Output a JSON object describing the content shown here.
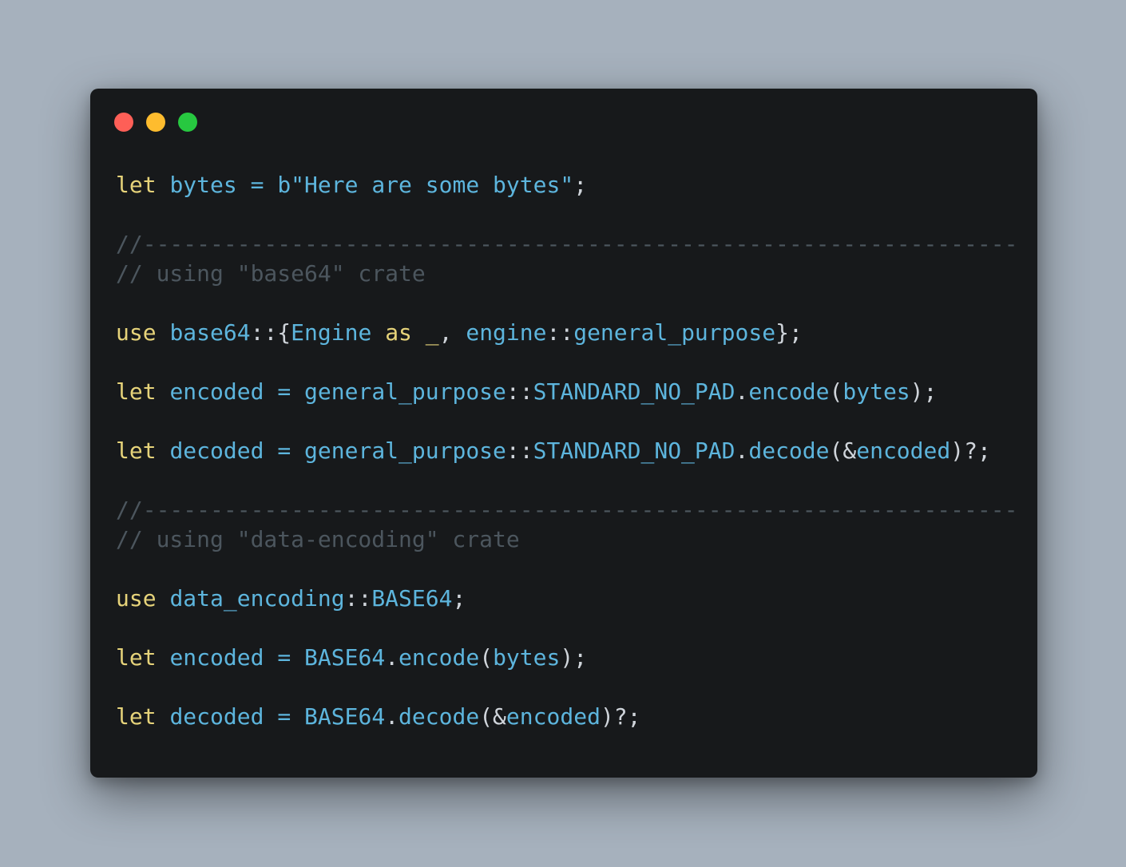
{
  "window": {
    "traffic_lights": [
      {
        "name": "close",
        "color": "#fe5f57"
      },
      {
        "name": "minimize",
        "color": "#febc2e"
      },
      {
        "name": "maximize",
        "color": "#27c840"
      }
    ]
  },
  "colors": {
    "background": "#a6b1bd",
    "editor": "#17191b",
    "keyword": "#e6d37a",
    "identifier": "#5db5dd",
    "punctuation": "#cfd4da",
    "comment": "#4c565e"
  },
  "code": {
    "lines": [
      [
        [
          "kw",
          "let"
        ],
        [
          "pn",
          " "
        ],
        [
          "id",
          "bytes"
        ],
        [
          "pn",
          " "
        ],
        [
          "id",
          "="
        ],
        [
          "pn",
          " "
        ],
        [
          "id",
          "b\"Here are some bytes\""
        ],
        [
          "pn",
          ";"
        ]
      ],
      [],
      [
        [
          "cm",
          "//-----------------------------------------------------------------"
        ]
      ],
      [
        [
          "cm",
          "// using \"base64\" crate"
        ]
      ],
      [],
      [
        [
          "kw",
          "use"
        ],
        [
          "pn",
          " "
        ],
        [
          "id",
          "base64"
        ],
        [
          "pn",
          "::{"
        ],
        [
          "id",
          "Engine"
        ],
        [
          "pn",
          " "
        ],
        [
          "kw",
          "as"
        ],
        [
          "pn",
          " "
        ],
        [
          "kw",
          "_"
        ],
        [
          "pn",
          ", "
        ],
        [
          "id",
          "engine"
        ],
        [
          "pn",
          "::"
        ],
        [
          "id",
          "general_purpose"
        ],
        [
          "pn",
          "};"
        ]
      ],
      [],
      [
        [
          "kw",
          "let"
        ],
        [
          "pn",
          " "
        ],
        [
          "id",
          "encoded"
        ],
        [
          "pn",
          " "
        ],
        [
          "id",
          "="
        ],
        [
          "pn",
          " "
        ],
        [
          "id",
          "general_purpose"
        ],
        [
          "pn",
          "::"
        ],
        [
          "id",
          "STANDARD_NO_PAD"
        ],
        [
          "pn",
          "."
        ],
        [
          "id",
          "encode"
        ],
        [
          "pn",
          "("
        ],
        [
          "id",
          "bytes"
        ],
        [
          "pn",
          ");"
        ]
      ],
      [],
      [
        [
          "kw",
          "let"
        ],
        [
          "pn",
          " "
        ],
        [
          "id",
          "decoded"
        ],
        [
          "pn",
          " "
        ],
        [
          "id",
          "="
        ],
        [
          "pn",
          " "
        ],
        [
          "id",
          "general_purpose"
        ],
        [
          "pn",
          "::"
        ],
        [
          "id",
          "STANDARD_NO_PAD"
        ],
        [
          "pn",
          "."
        ],
        [
          "id",
          "decode"
        ],
        [
          "pn",
          "(&"
        ],
        [
          "id",
          "encoded"
        ],
        [
          "pn",
          ")?;"
        ]
      ],
      [],
      [
        [
          "cm",
          "//-----------------------------------------------------------------"
        ]
      ],
      [
        [
          "cm",
          "// using \"data-encoding\" crate"
        ]
      ],
      [],
      [
        [
          "kw",
          "use"
        ],
        [
          "pn",
          " "
        ],
        [
          "id",
          "data_encoding"
        ],
        [
          "pn",
          "::"
        ],
        [
          "id",
          "BASE64"
        ],
        [
          "pn",
          ";"
        ]
      ],
      [],
      [
        [
          "kw",
          "let"
        ],
        [
          "pn",
          " "
        ],
        [
          "id",
          "encoded"
        ],
        [
          "pn",
          " "
        ],
        [
          "id",
          "="
        ],
        [
          "pn",
          " "
        ],
        [
          "id",
          "BASE64"
        ],
        [
          "pn",
          "."
        ],
        [
          "id",
          "encode"
        ],
        [
          "pn",
          "("
        ],
        [
          "id",
          "bytes"
        ],
        [
          "pn",
          ");"
        ]
      ],
      [],
      [
        [
          "kw",
          "let"
        ],
        [
          "pn",
          " "
        ],
        [
          "id",
          "decoded"
        ],
        [
          "pn",
          " "
        ],
        [
          "id",
          "="
        ],
        [
          "pn",
          " "
        ],
        [
          "id",
          "BASE64"
        ],
        [
          "pn",
          "."
        ],
        [
          "id",
          "decode"
        ],
        [
          "pn",
          "(&"
        ],
        [
          "id",
          "encoded"
        ],
        [
          "pn",
          ")?;"
        ]
      ]
    ]
  }
}
